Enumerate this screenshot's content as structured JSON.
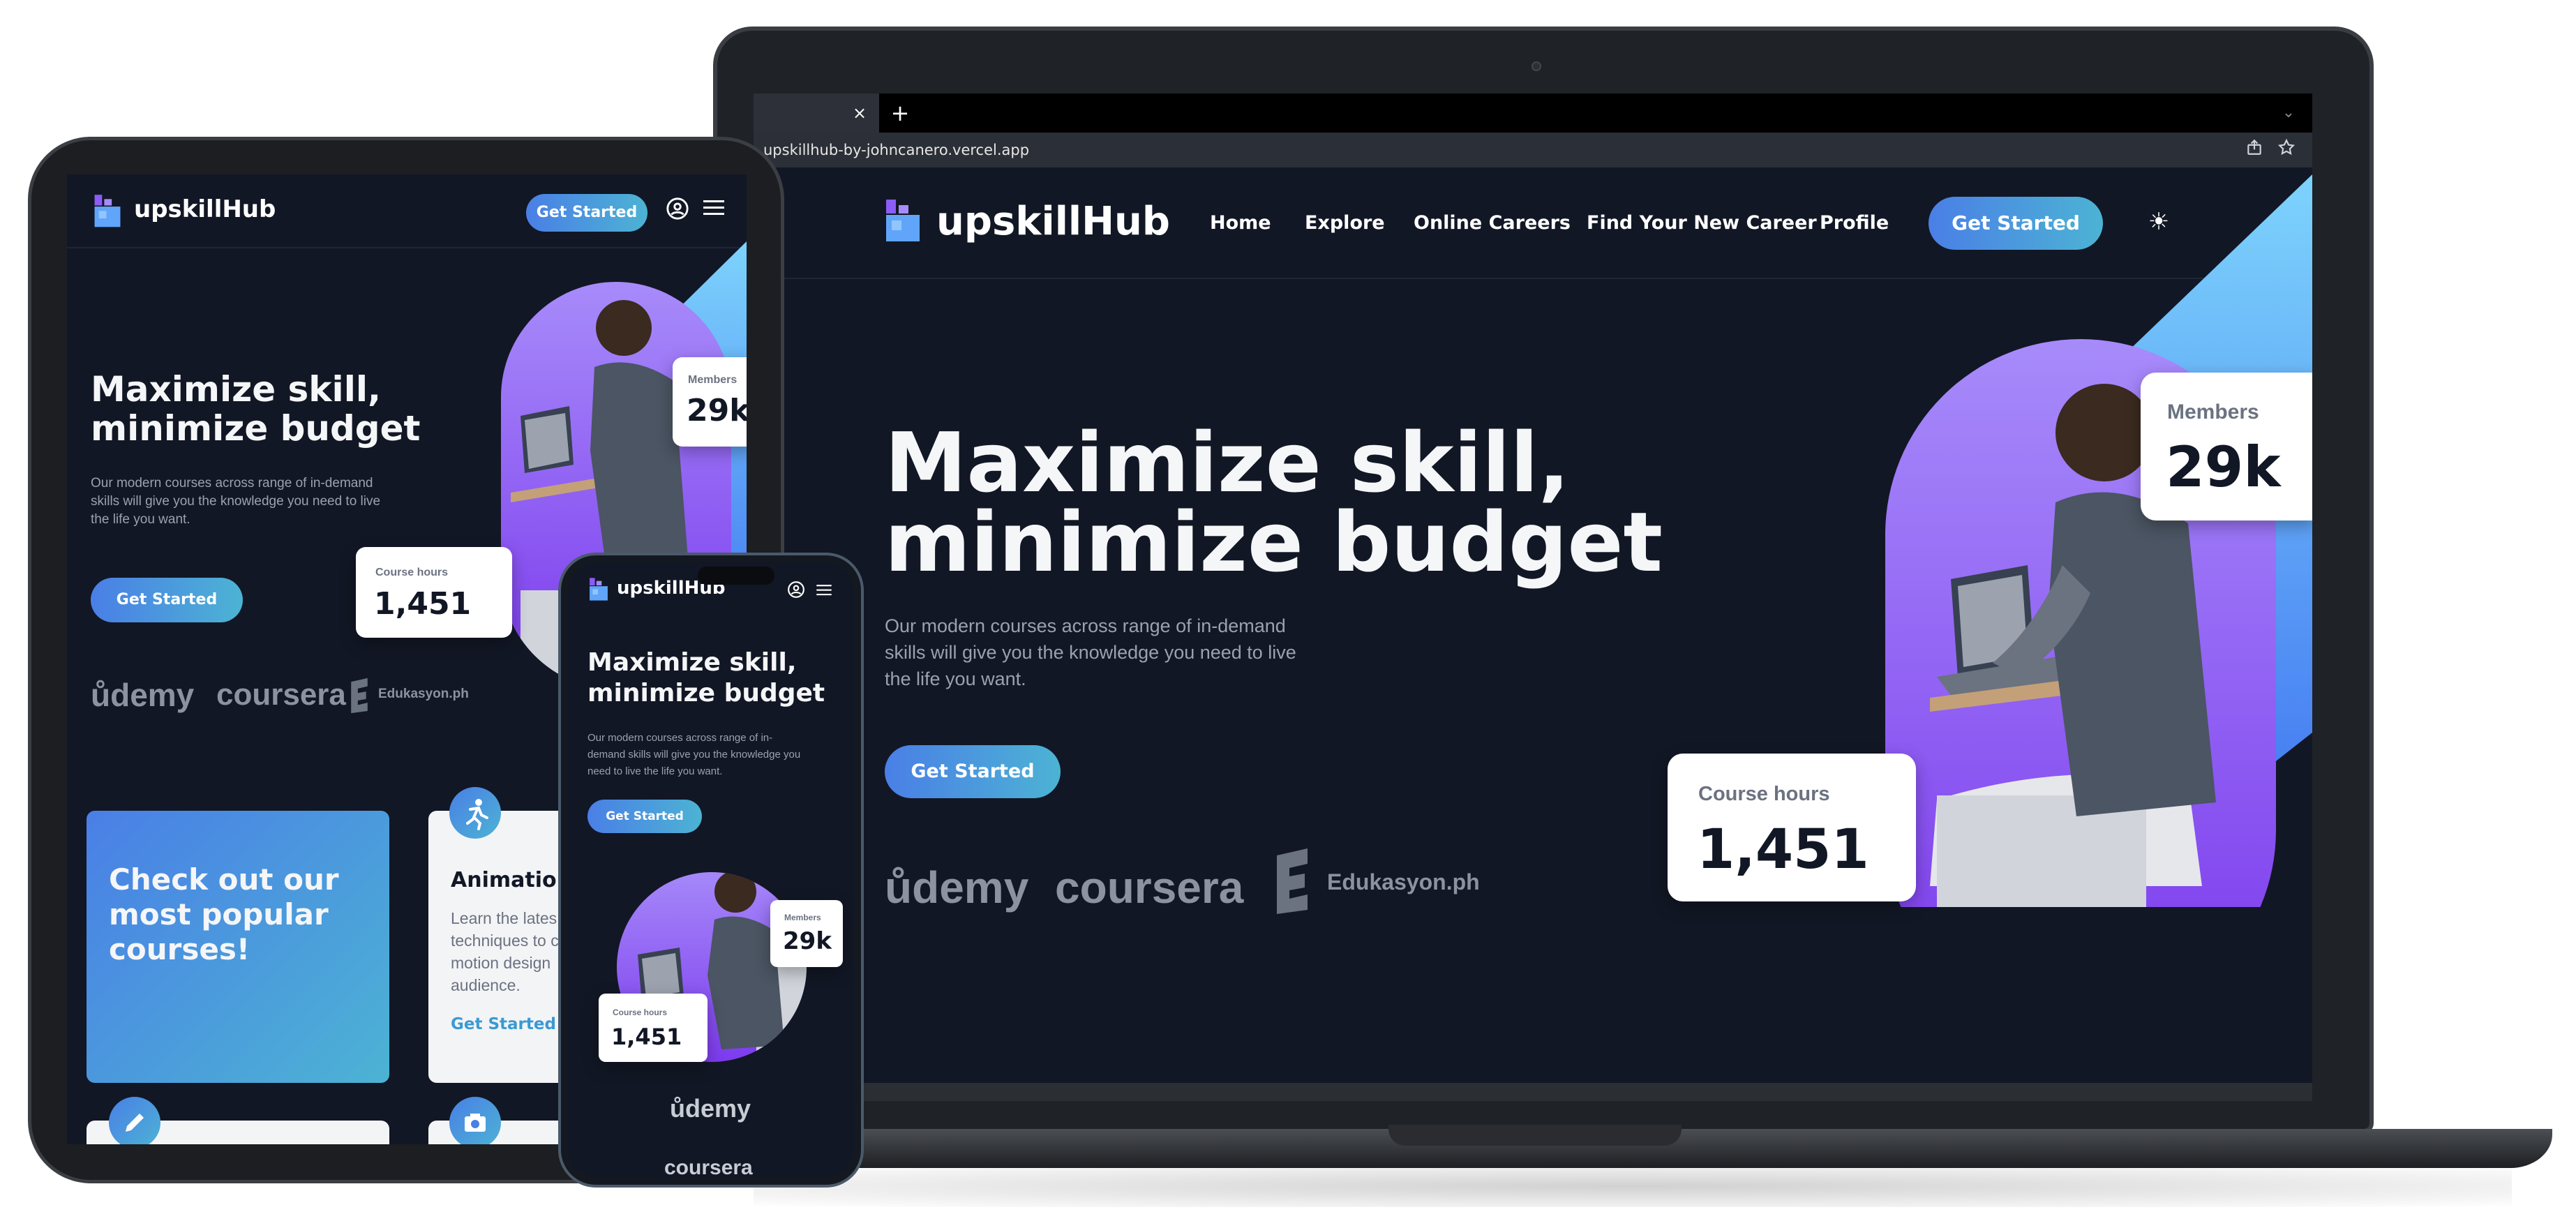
{
  "browser": {
    "url": "upskillhub-by-johncanero.vercel.app",
    "tab_close": "×",
    "tab_new": "+",
    "tab_chevron": "⌄",
    "share_icon": "share-icon",
    "star_icon": "star-icon"
  },
  "site": {
    "brand": "upskillHub",
    "nav": [
      "Home",
      "Explore",
      "Online Careers",
      "Find Your New Career",
      "Profile"
    ],
    "nav_cta": "Get Started",
    "theme_icon": "☀",
    "hero": {
      "title_line1": "Maximize skill,",
      "title_line2": "minimize budget",
      "desc_line1": "Our modern courses across range of in-demand",
      "desc_line2": "skills will give you the knowledge you need to live",
      "desc_line3": "the life you want.",
      "cta": "Get Started"
    },
    "partners": [
      "ůdemy",
      "coursera",
      "Edukasyon.ph"
    ],
    "stats": {
      "members_label": "Members",
      "members_value": "29k",
      "hours_label": "Course hours",
      "hours_value": "1,451"
    }
  },
  "tablet": {
    "desc_line1": "Our modern courses across range of in-demand",
    "desc_line2": "skills will give you the knowledge you need to live",
    "desc_line3": "the life you want.",
    "card_blue_line1": "Check out our",
    "card_blue_line2": "most popular",
    "card_blue_line3": "courses!",
    "card_title": "Animation",
    "card_line1": "Learn the lates",
    "card_line2": "techniques to c",
    "card_line3": "motion design",
    "card_line4": "audience.",
    "card_link": "Get Started"
  },
  "phone": {
    "title_line1": "Maximize skill,",
    "title_line2": "minimize budget",
    "desc_line1": "Our modern courses across range of in-",
    "desc_line2": "demand skills will give you the knowledge you",
    "desc_line3": "need to live the life you want.",
    "partner1": "ůdemy",
    "partner2": "coursera"
  },
  "colors": {
    "background": "#121725",
    "accent_start": "#4a7fe6",
    "accent_end": "#4cb3d4",
    "purple": "#8b5cf6"
  }
}
